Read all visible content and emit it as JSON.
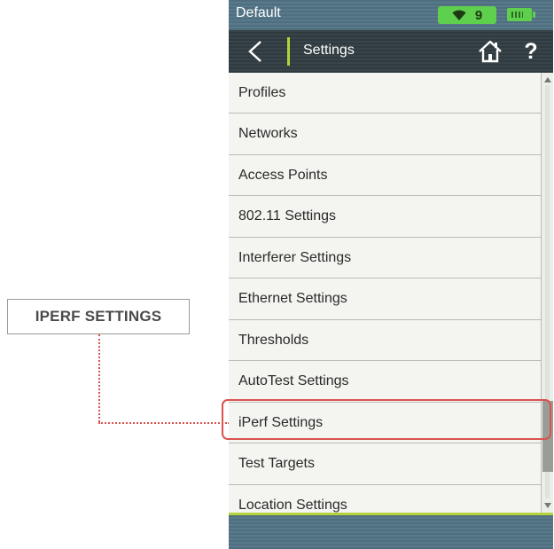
{
  "callout": {
    "label": "IPERF SETTINGS",
    "color": "#d9534f"
  },
  "status_bar": {
    "profile": "Default",
    "wifi_count": "9",
    "wifi_icon": "wifi-icon",
    "battery_icon": "battery-icon",
    "badge_color": "#5fcf4e"
  },
  "nav": {
    "title": "Settings",
    "back_icon": "chevron-left-icon",
    "home_icon": "home-icon",
    "help_label": "?",
    "accent_color": "#b4d23a"
  },
  "menu": {
    "items": [
      {
        "label": "Profiles"
      },
      {
        "label": "Networks"
      },
      {
        "label": "Access Points"
      },
      {
        "label": "802.11 Settings"
      },
      {
        "label": "Interferer Settings"
      },
      {
        "label": "Ethernet Settings"
      },
      {
        "label": "Thresholds"
      },
      {
        "label": "AutoTest Settings"
      },
      {
        "label": "iPerf Settings"
      },
      {
        "label": "Test Targets"
      },
      {
        "label": "Location Settings"
      }
    ],
    "highlighted": "iPerf Settings"
  }
}
